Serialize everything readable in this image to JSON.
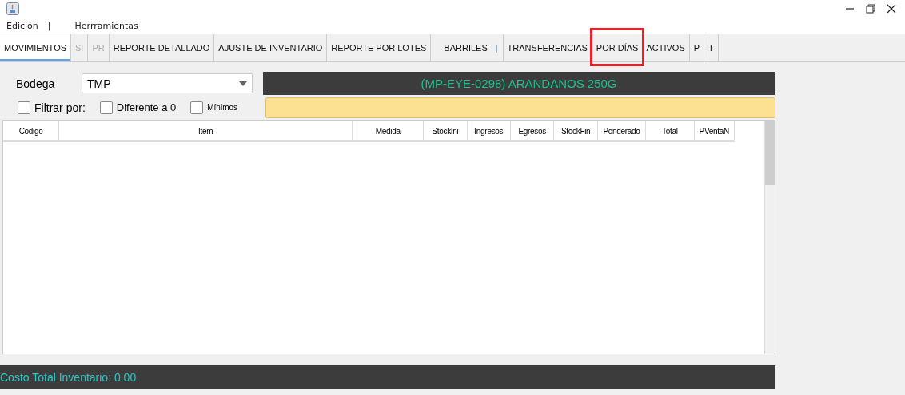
{
  "menu": [
    {
      "label": "Edición",
      "separator": "|"
    },
    {
      "label": "Herrramientas"
    }
  ],
  "tabs": [
    {
      "label": "MOVIMIENTOS",
      "selected": true,
      "disabled": false,
      "highlighted": false
    },
    {
      "label": "SI",
      "selected": false,
      "disabled": true,
      "highlighted": false
    },
    {
      "label": "PR",
      "selected": false,
      "disabled": true,
      "highlighted": false
    },
    {
      "label": "REPORTE DETALLADO",
      "selected": false,
      "disabled": false,
      "highlighted": false
    },
    {
      "label": "AJUSTE DE INVENTARIO",
      "selected": false,
      "disabled": false,
      "highlighted": false
    },
    {
      "label": "REPORTE POR LOTES",
      "selected": false,
      "disabled": false,
      "highlighted": false
    },
    {
      "label": "BARRILES",
      "suffix": "|",
      "selected": false,
      "disabled": false,
      "highlighted": false
    },
    {
      "label": "TRANSFERENCIAS",
      "selected": false,
      "disabled": false,
      "highlighted": false
    },
    {
      "label": "POR DÍAS",
      "selected": false,
      "disabled": false,
      "highlighted": true
    },
    {
      "label": "ACTIVOS",
      "selected": false,
      "disabled": false,
      "highlighted": false
    },
    {
      "label": "P",
      "selected": false,
      "disabled": false,
      "highlighted": false
    },
    {
      "label": "T",
      "selected": false,
      "disabled": false,
      "highlighted": false
    }
  ],
  "bodega": {
    "label": "Bodega",
    "value": "TMP"
  },
  "product_banner": "(MP-EYE-0298)  ARANDANOS 250G",
  "filters": [
    {
      "label": "Filtrar por:",
      "checked": false
    },
    {
      "label": "Diferente a 0",
      "checked": false
    },
    {
      "label": "Mínimos",
      "checked": false
    }
  ],
  "table": {
    "columns": [
      "Codigo",
      "Item",
      "Medida",
      "StockIni",
      "Ingresos",
      "Egresos",
      "StockFin",
      "Ponderado",
      "Total",
      "PVentaN"
    ]
  },
  "status_bar": "Costo Total Inventario: 0.00"
}
